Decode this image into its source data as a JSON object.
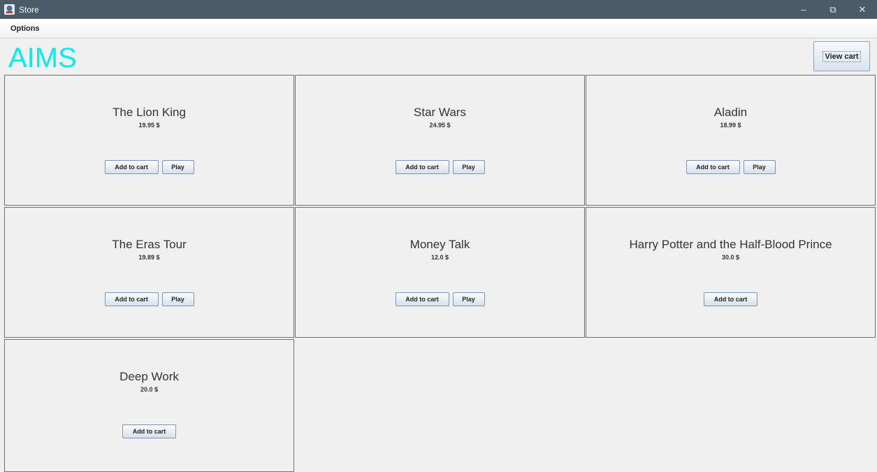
{
  "window": {
    "title": "Store",
    "icon": "app-icon",
    "controls": {
      "minimize": "–",
      "restore": "⧉",
      "close": "✕"
    }
  },
  "menu": {
    "items": [
      "Options"
    ]
  },
  "header": {
    "brand": "AIMS",
    "brand_color": "#00eeee",
    "view_cart_label": "View cart"
  },
  "products": [
    {
      "name": "The Lion King",
      "price": "19.95 $",
      "add_label": "Add to cart",
      "play_label": "Play"
    },
    {
      "name": "Star Wars",
      "price": "24.95 $",
      "add_label": "Add to cart",
      "play_label": "Play"
    },
    {
      "name": "Aladin",
      "price": "18.99 $",
      "add_label": "Add to cart",
      "play_label": "Play"
    },
    {
      "name": "The Eras Tour",
      "price": "19.89 $",
      "add_label": "Add to cart",
      "play_label": "Play"
    },
    {
      "name": "Money Talk",
      "price": "12.0 $",
      "add_label": "Add to cart",
      "play_label": "Play"
    },
    {
      "name": "Harry Potter and the Half-Blood Prince",
      "price": "30.0 $",
      "add_label": "Add to cart"
    },
    {
      "name": "Deep Work",
      "price": "20.0 $",
      "add_label": "Add to cart"
    }
  ]
}
